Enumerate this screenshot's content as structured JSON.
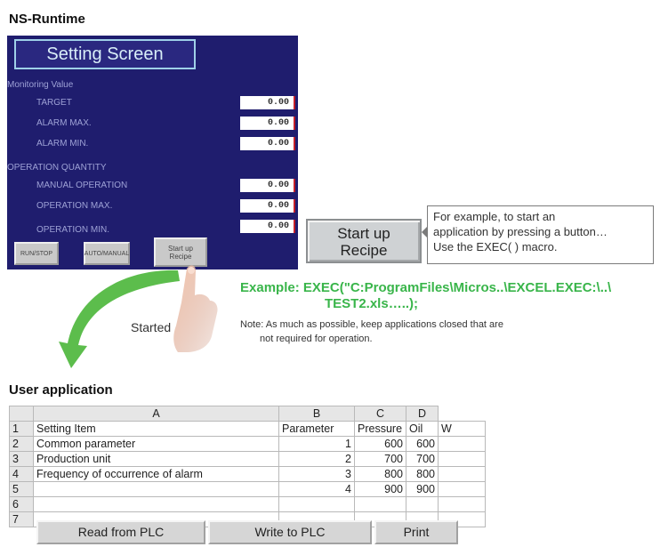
{
  "section1_title": "NS-Runtime",
  "ns": {
    "screen_title": "Setting Screen",
    "monitoring_header": "Monitoring Value",
    "rows": [
      {
        "label": "TARGET",
        "value": "0.00"
      },
      {
        "label": "ALARM MAX.",
        "value": "0.00"
      },
      {
        "label": "ALARM MIN.",
        "value": "0.00"
      }
    ],
    "operation_header": "OPERATION QUANTITY",
    "op_rows": [
      {
        "label": "MANUAL OPERATION",
        "value": "0.00"
      },
      {
        "label": "OPERATION MAX.",
        "value": "0.00"
      },
      {
        "label": "OPERATION MIN.",
        "value": "0.00"
      }
    ],
    "buttons": {
      "run_stop": "RUN/STOP",
      "auto_manual": "AUTO/MANUAL",
      "start_recipe_l1": "Start up",
      "start_recipe_l2": "Recipe"
    }
  },
  "big_button": {
    "line1": "Start up",
    "line2": "Recipe"
  },
  "callout": {
    "line1": "For example, to start an",
    "line2": "application by pressing a button…",
    "line3": "Use the EXEC( ) macro."
  },
  "example": {
    "line1": "Example: EXEC(\"C:ProgramFiles\\Micros..\\EXCEL.EXEC:\\..\\",
    "line2": "TEST2.xls…..);"
  },
  "note": {
    "line1": "Note: As much as possible, keep applications closed that are",
    "line2": "not required for operation."
  },
  "started_label": "Started",
  "section2_title": "User application",
  "sheet": {
    "columns": [
      "A",
      "B",
      "C",
      "D"
    ],
    "rows": [
      {
        "n": "1",
        "a": "Setting Item",
        "b": "Parameter",
        "c": "Pressure",
        "d": "Oil",
        "e": "W"
      },
      {
        "n": "2",
        "a": "Common parameter",
        "b": "1",
        "c": "600",
        "d": "600",
        "e": ""
      },
      {
        "n": "3",
        "a": "Production unit",
        "b": "2",
        "c": "700",
        "d": "700",
        "e": ""
      },
      {
        "n": "4",
        "a": "Frequency of occurrence of alarm",
        "b": "3",
        "c": "800",
        "d": "800",
        "e": ""
      },
      {
        "n": "5",
        "a": "",
        "b": "4",
        "c": "900",
        "d": "900",
        "e": ""
      },
      {
        "n": "6",
        "a": "",
        "b": "",
        "c": "",
        "d": "",
        "e": ""
      },
      {
        "n": "7",
        "a": "",
        "b": "",
        "c": "",
        "d": "",
        "e": ""
      }
    ],
    "buttons": {
      "read": "Read from PLC",
      "write": "Write to PLC",
      "print": "Print"
    }
  }
}
